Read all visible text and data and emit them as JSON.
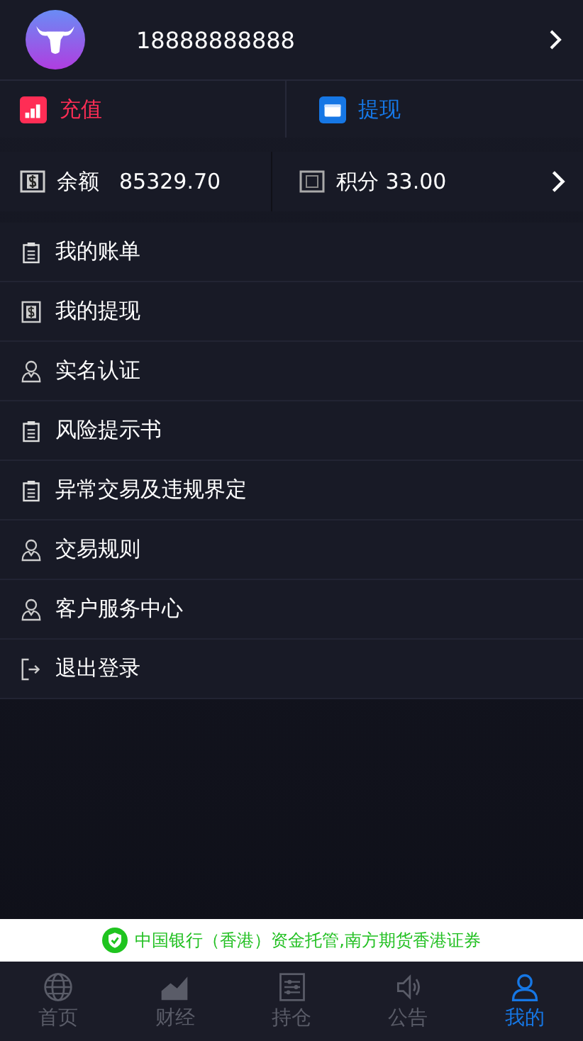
{
  "profile": {
    "phone": "18888888888"
  },
  "actions": [
    {
      "kind": "deposit",
      "label": "充值"
    },
    {
      "kind": "withdraw",
      "label": "提现"
    }
  ],
  "balance": {
    "label": "余额",
    "value": "85329.70",
    "points_label": "积分 33.00"
  },
  "menu": [
    {
      "kind": "bill",
      "label": "我的账单"
    },
    {
      "kind": "cash",
      "label": "我的提现"
    },
    {
      "kind": "person",
      "label": "实名认证"
    },
    {
      "kind": "bill",
      "label": "风险提示书"
    },
    {
      "kind": "bill",
      "label": "异常交易及违规界定"
    },
    {
      "kind": "person",
      "label": "交易规则"
    },
    {
      "kind": "person",
      "label": "客户服务中心"
    },
    {
      "kind": "exit",
      "label": "退出登录"
    }
  ],
  "notice": "中国银行（香港）资金托管,南方期货香港证券",
  "tabs": [
    {
      "label": "首页",
      "selected": false
    },
    {
      "label": "财经",
      "selected": false
    },
    {
      "label": "持仓",
      "selected": false
    },
    {
      "label": "公告",
      "selected": false
    },
    {
      "label": "我的",
      "selected": true
    }
  ]
}
